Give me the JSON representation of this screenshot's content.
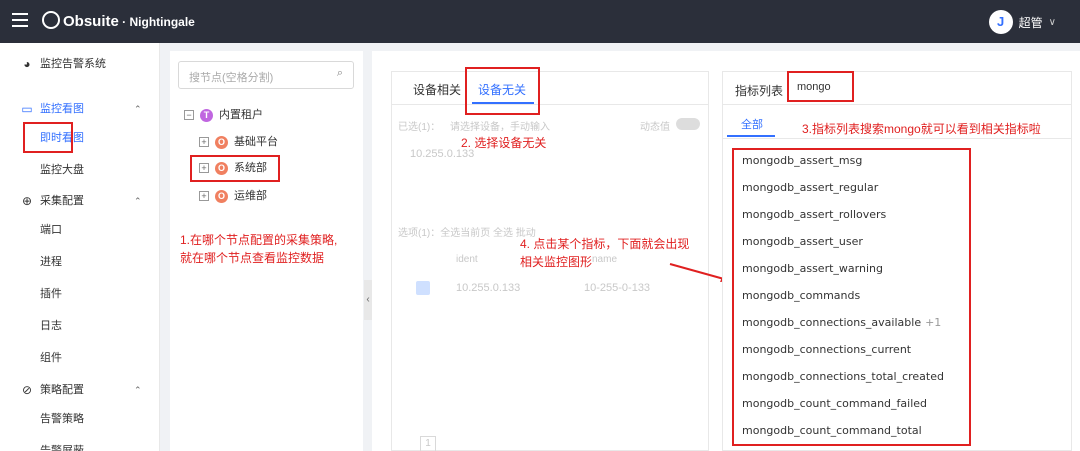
{
  "topbar": {
    "logo_main": "Obsuite",
    "logo_sep": " · ",
    "logo_sub": "Nightingale",
    "user_avatar": "J",
    "user_name": "超管"
  },
  "sidebar": {
    "monitor_system": "监控告警系统",
    "group_view": "监控看图",
    "view_instant": "即时看图",
    "view_dashboard": "监控大盘",
    "group_collect": "采集配置",
    "collect_items": [
      "端口",
      "进程",
      "插件",
      "日志",
      "组件"
    ],
    "group_policy": "策略配置",
    "policy_items": [
      "告警策略",
      "告警屏蔽"
    ]
  },
  "tree": {
    "search_placeholder": "搜节点(空格分割)",
    "root": "内置租户",
    "root_badge": "T",
    "children": [
      {
        "label": "基础平台",
        "badge": "O"
      },
      {
        "label": "系统部",
        "badge": "O"
      },
      {
        "label": "运维部",
        "badge": "O"
      }
    ]
  },
  "device_panel": {
    "tab_related": "设备相关",
    "tab_unrelated": "设备无关",
    "selected_label": "已选(1)：",
    "selected_note": "请选择设备，手动输入",
    "switch_label": "动态值",
    "selected_ip": "10.255.0.133",
    "options_label": "选项(1)：全选当前页  全选  批动  ",
    "col_ident": "ident",
    "col_name": "name",
    "row_ident": "10.255.0.133",
    "row_name": "10-255-0-133",
    "page": "1"
  },
  "metric_panel": {
    "title": "指标列表",
    "search_value": "mongo",
    "tab_all": "全部",
    "metrics": [
      "mongodb_assert_msg",
      "mongodb_assert_regular",
      "mongodb_assert_rollovers",
      "mongodb_assert_user",
      "mongodb_assert_warning",
      "mongodb_commands",
      "mongodb_connections_available",
      "mongodb_connections_current",
      "mongodb_connections_total_created",
      "mongodb_count_command_failed",
      "mongodb_count_command_total"
    ],
    "extra_badge": "+1"
  },
  "annotations": {
    "step1_line1": "1.在哪个节点配置的采集策略,",
    "step1_line2": "就在哪个节点查看监控数据",
    "step2": "2. 选择设备无关",
    "step3": "3.指标列表搜索mongo就可以看到相关指标啦",
    "step4_line1": "4. 点击某个指标，下面就会出现",
    "step4_line2": "相关监控图形"
  }
}
